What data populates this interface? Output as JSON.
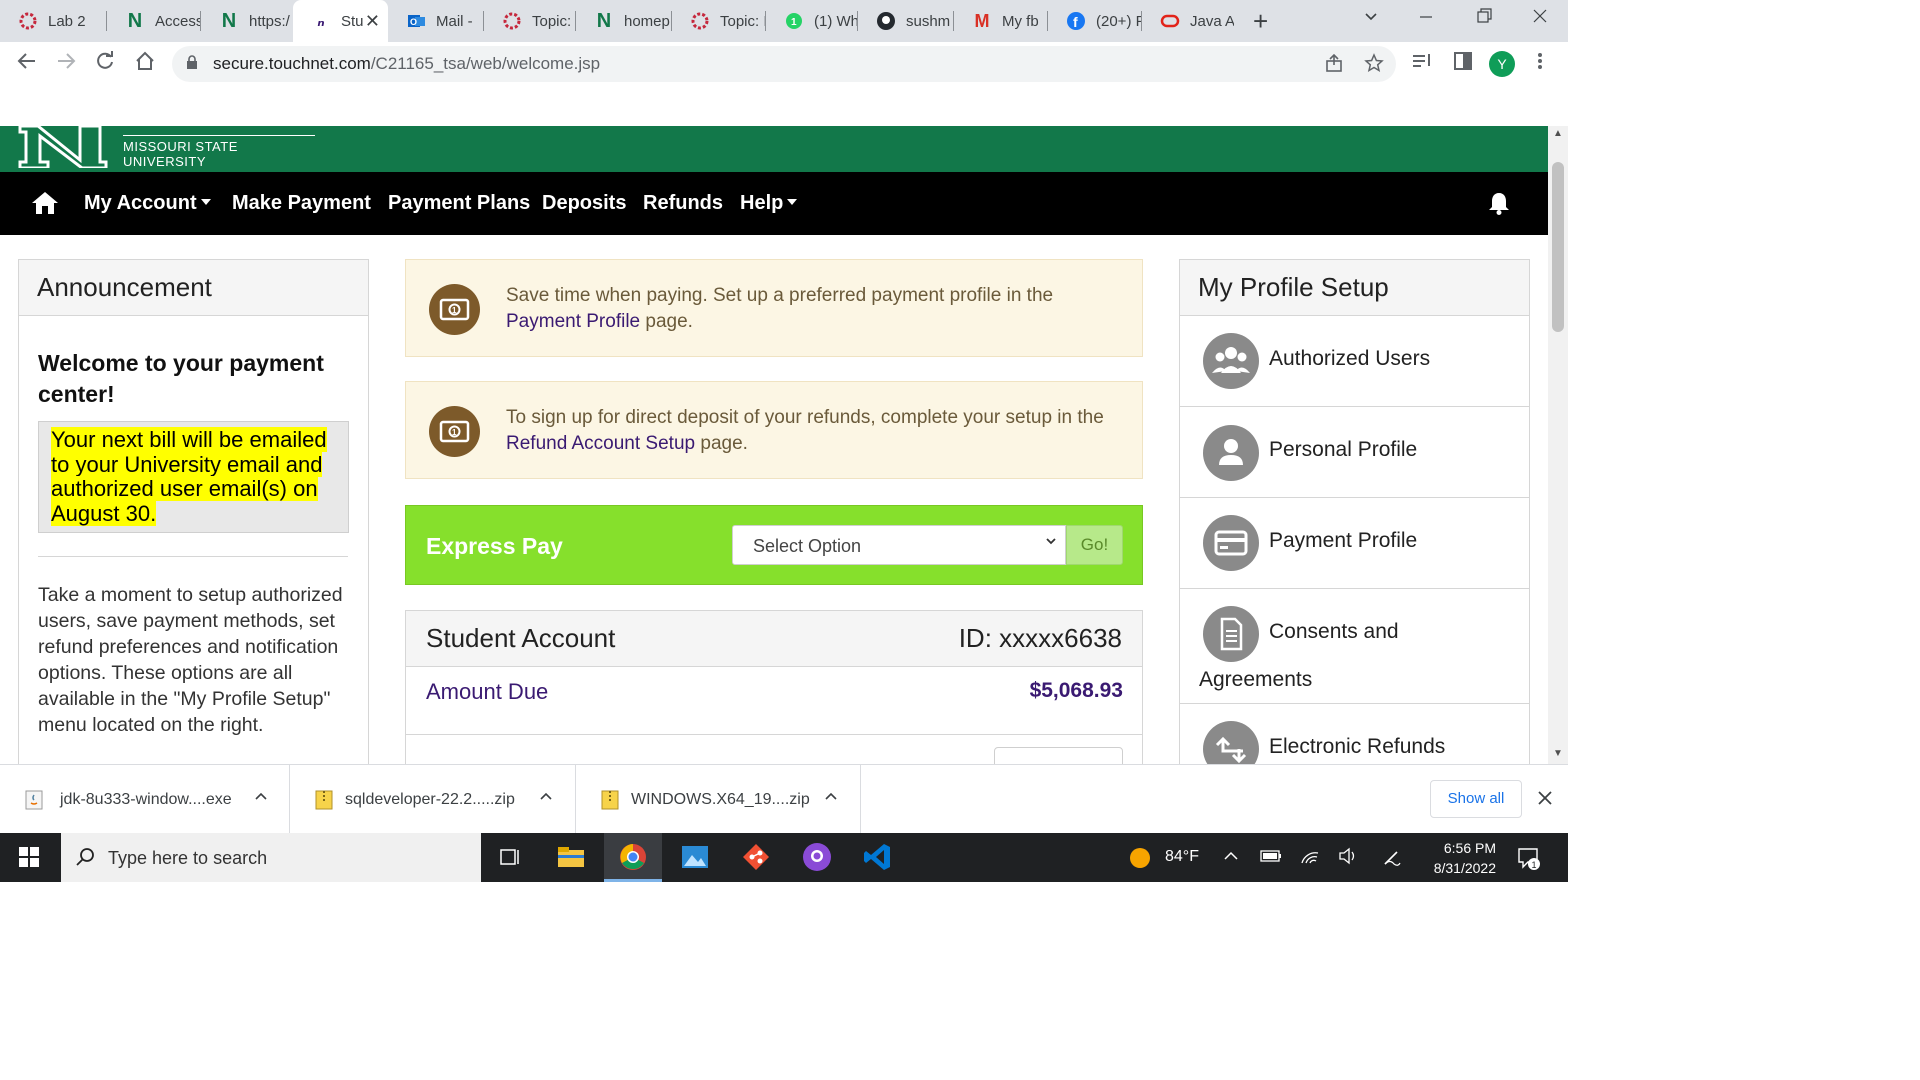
{
  "browser": {
    "tabs": [
      {
        "label": "Lab 2",
        "icon": "asu-icon"
      },
      {
        "label": "Access",
        "icon": "n-logo-icon"
      },
      {
        "label": "https:/",
        "icon": "n-logo-icon"
      },
      {
        "label": "Stu",
        "icon": "touchnet-icon",
        "active": true
      },
      {
        "label": "Mail -",
        "icon": "outlook-icon"
      },
      {
        "label": "Topic: I",
        "icon": "asu-icon"
      },
      {
        "label": "homep",
        "icon": "n-logo-icon"
      },
      {
        "label": "Topic: I",
        "icon": "asu-icon"
      },
      {
        "label": "(1) Wh",
        "icon": "whatsapp-icon"
      },
      {
        "label": "sushm",
        "icon": "github-icon"
      },
      {
        "label": "My fb",
        "icon": "gmail-icon"
      },
      {
        "label": "(20+) F",
        "icon": "facebook-icon"
      },
      {
        "label": "Java A",
        "icon": "oracle-icon"
      }
    ],
    "close_glyph": "✕",
    "new_tab_glyph": "+",
    "url_host": "secure.touchnet.com",
    "url_path": "/C21165_tsa/web/welcome.jsp",
    "avatar_letter": "Y"
  },
  "site": {
    "university": "MISSOURI STATE UNIVERSITY",
    "nav": {
      "my_account": "My Account",
      "make_payment": "Make Payment",
      "payment_plans": "Payment Plans",
      "deposits": "Deposits",
      "refunds": "Refunds",
      "help": "Help"
    },
    "announcement": {
      "title": "Announcement",
      "welcome": "Welcome to your payment center!",
      "bill_notice": "Your next bill will be emailed to your University email and authorized user email(s) on August 30.",
      "body": "Take a moment to setup authorized users, save payment methods, set refund preferences and notification options. These options are all available in the \"My Profile Setup\" menu located on the right."
    },
    "notices": [
      {
        "pre": "Save time when paying. Set up a preferred payment profile in the ",
        "link": "Payment Profile",
        "post": " page."
      },
      {
        "pre": "To sign up for direct deposit of your refunds, complete your setup in the ",
        "link": "Refund Account Setup",
        "post": " page."
      }
    ],
    "express_pay": {
      "label": "Express Pay",
      "select_value": "Select Option",
      "go": "Go!"
    },
    "student_account": {
      "title": "Student Account",
      "id": "ID: xxxxx6638",
      "amount_due_label": "Amount Due",
      "amount_due_value": "$5,068.93"
    },
    "profile_setup": {
      "title": "My Profile Setup",
      "items": [
        {
          "label": "Authorized Users",
          "icon": "users-icon"
        },
        {
          "label": "Personal Profile",
          "icon": "person-icon"
        },
        {
          "label": "Payment Profile",
          "icon": "card-icon"
        },
        {
          "label_line1": "Consents and",
          "label_line2": "Agreements",
          "icon": "document-icon"
        },
        {
          "label": "Electronic Refunds",
          "icon": "refund-icon"
        }
      ]
    }
  },
  "downloads": {
    "items": [
      {
        "name": "jdk-8u333-window....exe"
      },
      {
        "name": "sqldeveloper-22.2.....zip"
      },
      {
        "name": "WINDOWS.X64_19....zip"
      }
    ],
    "show_all": "Show all"
  },
  "taskbar": {
    "search_placeholder": "Type here to search",
    "weather": "84°F",
    "time": "6:56 PM",
    "date": "8/31/2022",
    "notification_count": "1"
  }
}
